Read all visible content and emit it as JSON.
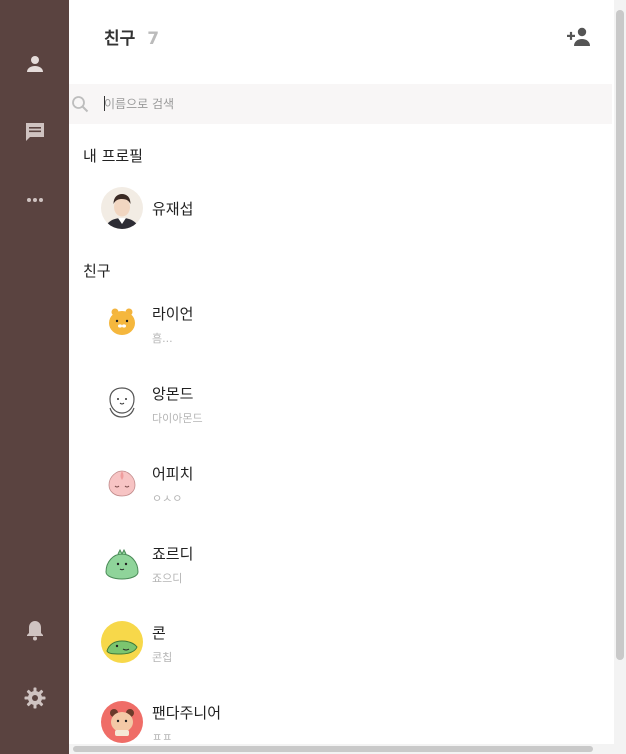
{
  "sidebar": {
    "icons": [
      "person-icon",
      "chat-icon",
      "more-icon",
      "bell-icon",
      "gear-icon"
    ],
    "background": "#5a4340"
  },
  "header": {
    "title": "친구",
    "count": "7"
  },
  "search": {
    "placeholder": "이름으로 검색",
    "value": ""
  },
  "my_profile": {
    "section_label": "내 프로필",
    "name": "유재섭"
  },
  "friends": {
    "section_label": "친구",
    "items": [
      {
        "name": "라이언",
        "status": "흠...",
        "avatar": "ryan"
      },
      {
        "name": "앙몬드",
        "status": "다이아몬드",
        "avatar": "angmond"
      },
      {
        "name": "어피치",
        "status": "ㅇㅅㅇ",
        "avatar": "apeach"
      },
      {
        "name": "죠르디",
        "status": "죠으디",
        "avatar": "jordy"
      },
      {
        "name": "콘",
        "status": "콘칩",
        "avatar": "con"
      },
      {
        "name": "팬다주니어",
        "status": "ㅍㅍ",
        "avatar": "panda-jr"
      }
    ]
  }
}
